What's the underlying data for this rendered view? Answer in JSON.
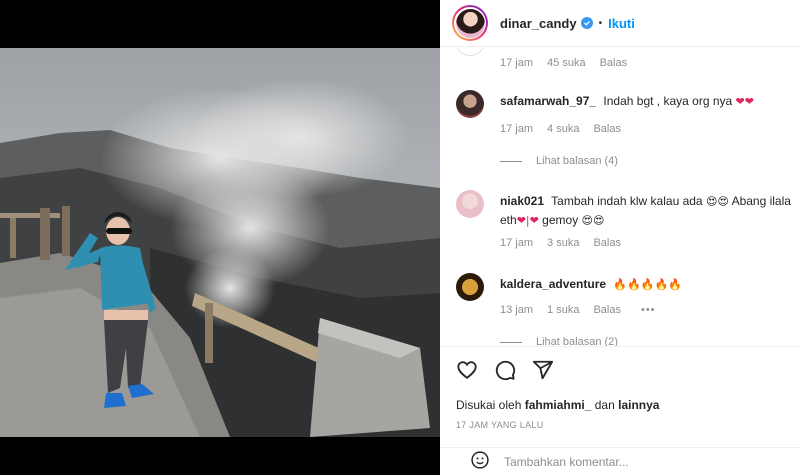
{
  "header": {
    "username": "dinar_candy",
    "separator": "•",
    "follow_label": "Ikuti"
  },
  "comments": {
    "first_meta": {
      "time": "17 jam",
      "likes": "45 suka",
      "reply": "Balas"
    },
    "items": [
      {
        "user": "safamarwah_97_",
        "text": "Indah bgt , kaya org nya",
        "emoji": "❤❤",
        "meta": {
          "time": "17 jam",
          "likes": "4 suka",
          "reply": "Balas"
        },
        "replies_label": "Lihat balasan (4)"
      },
      {
        "user": "niak021",
        "text": "Tambah indah klw kalau ada",
        "emoji": "😍😍",
        "text2": "Abang ilala",
        "text3": "eth",
        "emoji2": "❤|❤",
        "text4": "gemoy",
        "emoji3": "😍😍",
        "meta": {
          "time": "17 jam",
          "likes": "3 suka",
          "reply": "Balas"
        }
      },
      {
        "user": "kaldera_adventure",
        "emoji": "🔥🔥🔥🔥🔥",
        "meta": {
          "time": "13 jam",
          "likes": "1 suka",
          "reply": "Balas",
          "more": "•••"
        },
        "replies_label": "Lihat balasan (2)"
      }
    ]
  },
  "actions": {
    "liked_by_prefix": "Disukai oleh",
    "liked_by_user": "fahmiahmi_",
    "liked_by_and": "dan",
    "liked_by_others": "lainnya",
    "timestamp": "17 JAM YANG LALU"
  },
  "add_comment": {
    "placeholder": "Tambahkan komentar..."
  },
  "icons": {
    "like": "heart-icon",
    "comment": "comment-icon",
    "share": "share-icon",
    "emoji": "emoji-icon",
    "verified": "verified-badge-icon"
  },
  "colors": {
    "follow": "#0095f6",
    "verified": "#3897f0",
    "muted": "#8e8e8e",
    "text": "#262626"
  }
}
